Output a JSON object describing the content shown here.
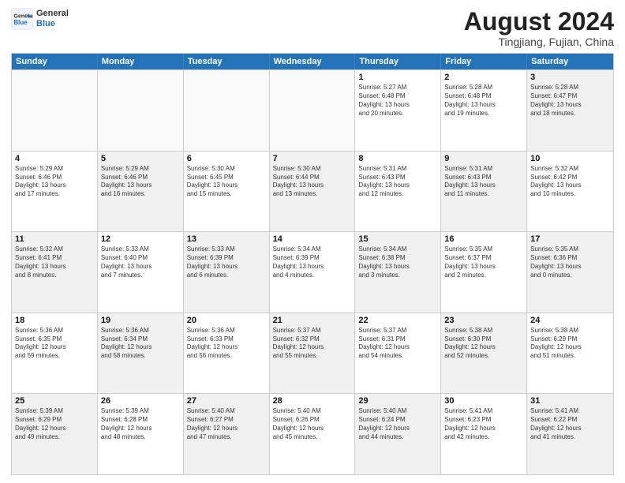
{
  "header": {
    "logo_line1": "General",
    "logo_line2": "Blue",
    "title": "August 2024",
    "subtitle": "Tingjiang, Fujian, China"
  },
  "days_of_week": [
    "Sunday",
    "Monday",
    "Tuesday",
    "Wednesday",
    "Thursday",
    "Friday",
    "Saturday"
  ],
  "weeks": [
    [
      {
        "day": "",
        "text": "",
        "empty": true
      },
      {
        "day": "",
        "text": "",
        "empty": true
      },
      {
        "day": "",
        "text": "",
        "empty": true
      },
      {
        "day": "",
        "text": "",
        "empty": true
      },
      {
        "day": "1",
        "text": "Sunrise: 5:27 AM\nSunset: 6:48 PM\nDaylight: 13 hours\nand 20 minutes."
      },
      {
        "day": "2",
        "text": "Sunrise: 5:28 AM\nSunset: 6:48 PM\nDaylight: 13 hours\nand 19 minutes."
      },
      {
        "day": "3",
        "text": "Sunrise: 5:28 AM\nSunset: 6:47 PM\nDaylight: 13 hours\nand 18 minutes.",
        "shaded": true
      }
    ],
    [
      {
        "day": "4",
        "text": "Sunrise: 5:29 AM\nSunset: 6:46 PM\nDaylight: 13 hours\nand 17 minutes."
      },
      {
        "day": "5",
        "text": "Sunrise: 5:29 AM\nSunset: 6:46 PM\nDaylight: 13 hours\nand 16 minutes.",
        "shaded": true
      },
      {
        "day": "6",
        "text": "Sunrise: 5:30 AM\nSunset: 6:45 PM\nDaylight: 13 hours\nand 15 minutes."
      },
      {
        "day": "7",
        "text": "Sunrise: 5:30 AM\nSunset: 6:44 PM\nDaylight: 13 hours\nand 13 minutes.",
        "shaded": true
      },
      {
        "day": "8",
        "text": "Sunrise: 5:31 AM\nSunset: 6:43 PM\nDaylight: 13 hours\nand 12 minutes."
      },
      {
        "day": "9",
        "text": "Sunrise: 5:31 AM\nSunset: 6:43 PM\nDaylight: 13 hours\nand 11 minutes.",
        "shaded": true
      },
      {
        "day": "10",
        "text": "Sunrise: 5:32 AM\nSunset: 6:42 PM\nDaylight: 13 hours\nand 10 minutes."
      }
    ],
    [
      {
        "day": "11",
        "text": "Sunrise: 5:32 AM\nSunset: 6:41 PM\nDaylight: 13 hours\nand 8 minutes.",
        "shaded": true
      },
      {
        "day": "12",
        "text": "Sunrise: 5:33 AM\nSunset: 6:40 PM\nDaylight: 13 hours\nand 7 minutes."
      },
      {
        "day": "13",
        "text": "Sunrise: 5:33 AM\nSunset: 6:39 PM\nDaylight: 13 hours\nand 6 minutes.",
        "shaded": true
      },
      {
        "day": "14",
        "text": "Sunrise: 5:34 AM\nSunset: 6:39 PM\nDaylight: 13 hours\nand 4 minutes."
      },
      {
        "day": "15",
        "text": "Sunrise: 5:34 AM\nSunset: 6:38 PM\nDaylight: 13 hours\nand 3 minutes.",
        "shaded": true
      },
      {
        "day": "16",
        "text": "Sunrise: 5:35 AM\nSunset: 6:37 PM\nDaylight: 13 hours\nand 2 minutes."
      },
      {
        "day": "17",
        "text": "Sunrise: 5:35 AM\nSunset: 6:36 PM\nDaylight: 13 hours\nand 0 minutes.",
        "shaded": true
      }
    ],
    [
      {
        "day": "18",
        "text": "Sunrise: 5:36 AM\nSunset: 6:35 PM\nDaylight: 12 hours\nand 59 minutes."
      },
      {
        "day": "19",
        "text": "Sunrise: 5:36 AM\nSunset: 6:34 PM\nDaylight: 12 hours\nand 58 minutes.",
        "shaded": true
      },
      {
        "day": "20",
        "text": "Sunrise: 5:36 AM\nSunset: 6:33 PM\nDaylight: 12 hours\nand 56 minutes."
      },
      {
        "day": "21",
        "text": "Sunrise: 5:37 AM\nSunset: 6:32 PM\nDaylight: 12 hours\nand 55 minutes.",
        "shaded": true
      },
      {
        "day": "22",
        "text": "Sunrise: 5:37 AM\nSunset: 6:31 PM\nDaylight: 12 hours\nand 54 minutes."
      },
      {
        "day": "23",
        "text": "Sunrise: 5:38 AM\nSunset: 6:30 PM\nDaylight: 12 hours\nand 52 minutes.",
        "shaded": true
      },
      {
        "day": "24",
        "text": "Sunrise: 5:38 AM\nSunset: 6:29 PM\nDaylight: 12 hours\nand 51 minutes."
      }
    ],
    [
      {
        "day": "25",
        "text": "Sunrise: 5:39 AM\nSunset: 6:29 PM\nDaylight: 12 hours\nand 49 minutes.",
        "shaded": true
      },
      {
        "day": "26",
        "text": "Sunrise: 5:39 AM\nSunset: 6:28 PM\nDaylight: 12 hours\nand 48 minutes."
      },
      {
        "day": "27",
        "text": "Sunrise: 5:40 AM\nSunset: 6:27 PM\nDaylight: 12 hours\nand 47 minutes.",
        "shaded": true
      },
      {
        "day": "28",
        "text": "Sunrise: 5:40 AM\nSunset: 6:26 PM\nDaylight: 12 hours\nand 45 minutes."
      },
      {
        "day": "29",
        "text": "Sunrise: 5:40 AM\nSunset: 6:24 PM\nDaylight: 12 hours\nand 44 minutes.",
        "shaded": true
      },
      {
        "day": "30",
        "text": "Sunrise: 5:41 AM\nSunset: 6:23 PM\nDaylight: 12 hours\nand 42 minutes."
      },
      {
        "day": "31",
        "text": "Sunrise: 5:41 AM\nSunset: 6:22 PM\nDaylight: 12 hours\nand 41 minutes.",
        "shaded": true
      }
    ]
  ]
}
